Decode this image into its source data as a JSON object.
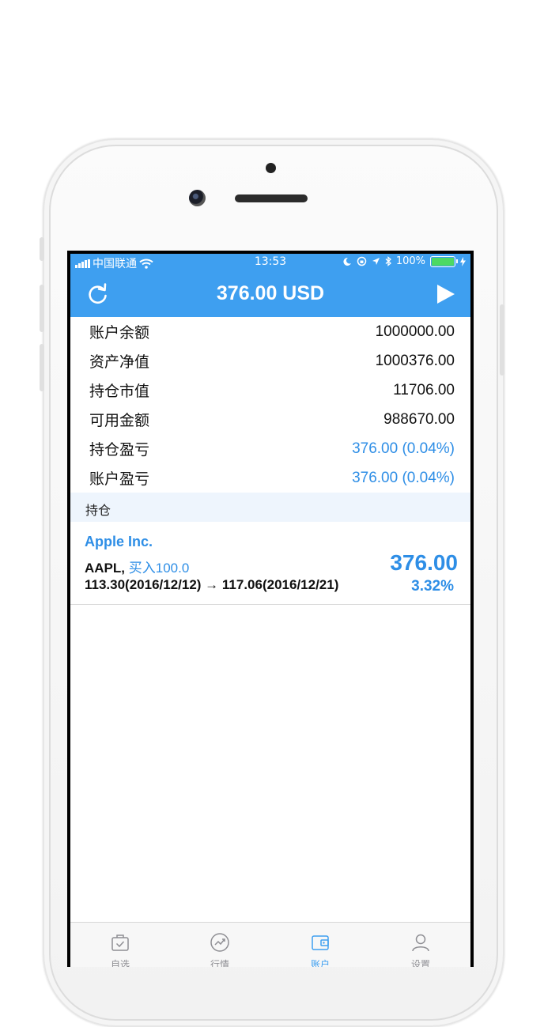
{
  "status_bar": {
    "carrier": "中国联通",
    "time": "13:53",
    "battery": "100%"
  },
  "nav": {
    "title": "376.00 USD",
    "refresh_icon": "refresh-icon",
    "play_icon": "play-icon"
  },
  "account_rows": [
    {
      "label": "账户余额",
      "value": "1000000.00",
      "color": "#111111"
    },
    {
      "label": "资产净值",
      "value": "1000376.00",
      "color": "#111111"
    },
    {
      "label": "持仓市值",
      "value": "11706.00",
      "color": "#111111"
    },
    {
      "label": "可用金额",
      "value": "988670.00",
      "color": "#111111"
    },
    {
      "label": "持仓盈亏",
      "value": "376.00 (0.04%)",
      "color": "#2e8ee6"
    },
    {
      "label": "账户盈亏",
      "value": "376.00 (0.04%)",
      "color": "#2e8ee6"
    }
  ],
  "section_header": "持仓",
  "position": {
    "name": "Apple Inc.",
    "symbol": "AAPL,",
    "action": "买入100.0",
    "price_change": "113.30(2016/12/12) → 117.06(2016/12/21)",
    "pl": "376.00",
    "pct": "3.32%"
  },
  "tabs": [
    {
      "label": "自选",
      "icon": "bag-check-icon",
      "active": false
    },
    {
      "label": "行情",
      "icon": "trend-chart-icon",
      "active": false
    },
    {
      "label": "账户",
      "icon": "wallet-icon",
      "active": true
    },
    {
      "label": "设置",
      "icon": "person-icon",
      "active": false
    }
  ],
  "colors": {
    "accent": "#3e9ff0",
    "value_blue": "#2e8ee6",
    "section_bg": "#eef5fd"
  }
}
